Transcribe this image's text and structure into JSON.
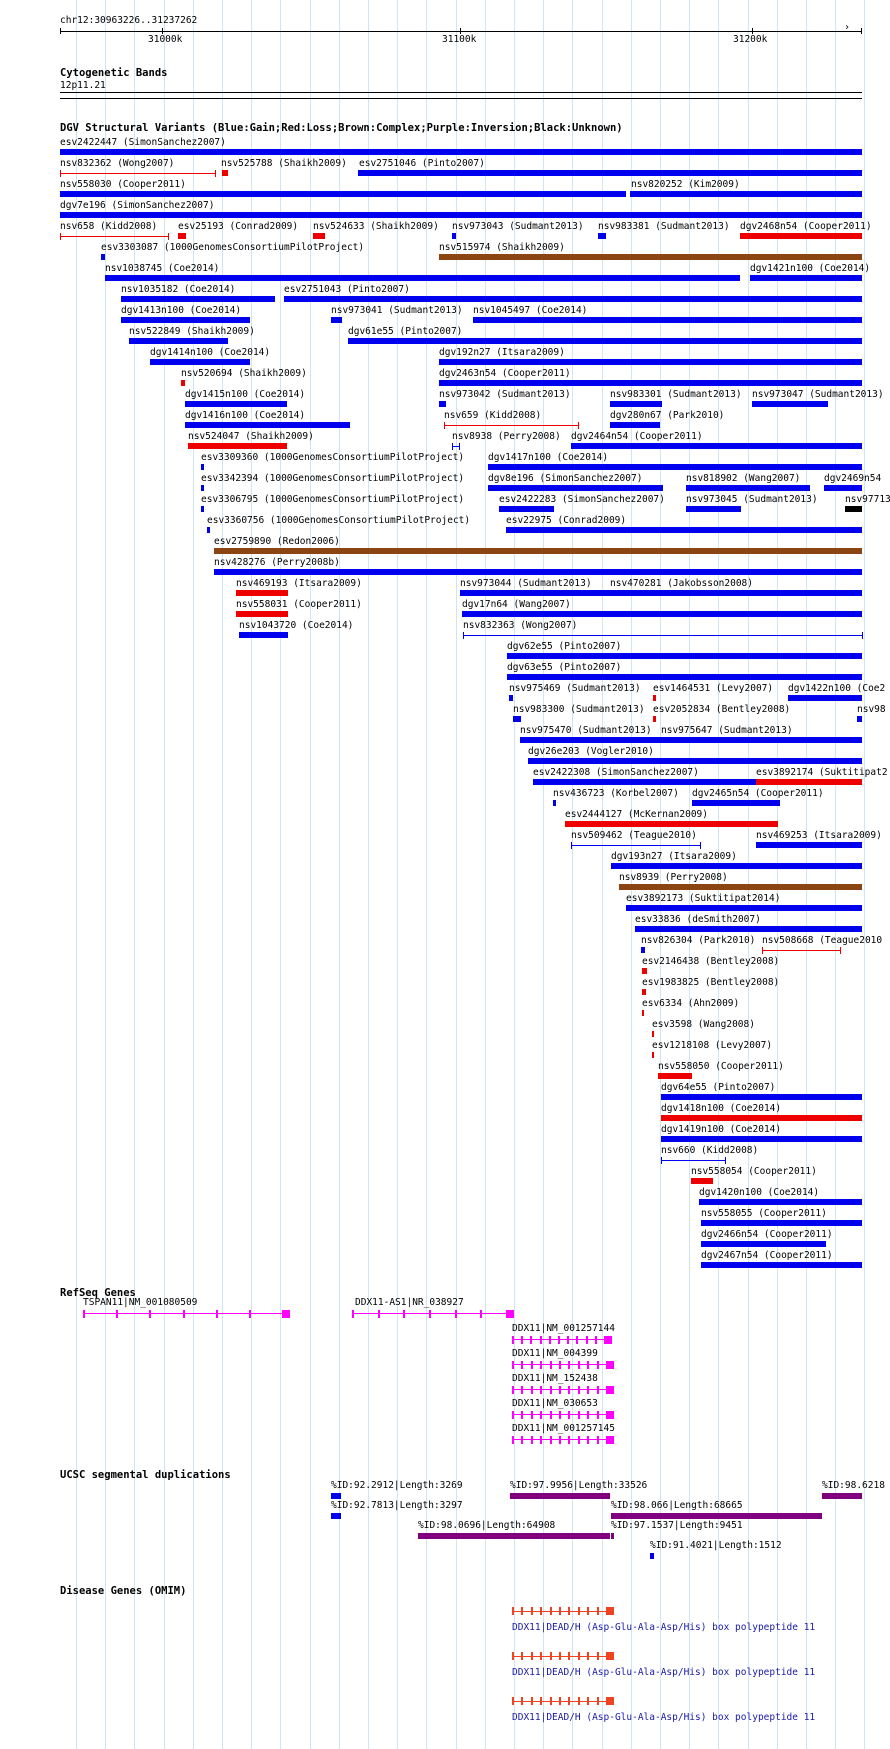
{
  "colors": {
    "gain": "#0000ee",
    "loss": "#ee0000",
    "complex": "#8b4513",
    "unknown": "#000000",
    "refseq": "#ff00ff",
    "segdup": "#800080",
    "omim": "#ee4422",
    "omim_text": "#1a1aa8",
    "grid": "#cfe6f2"
  },
  "ruler": {
    "position": "chr12:30963226..31237262",
    "ticks": [
      "31000k",
      "31100k",
      "31200k"
    ]
  },
  "cytoband": {
    "title": "Cytogenetic Bands",
    "band": "12p11.21"
  },
  "dgv": {
    "title": "DGV Structural Variants (Blue:Gain;Red:Loss;Brown:Complex;Purple:Inversion;Black:Unknown)",
    "features": [
      {
        "label": "esv2422447 (SimonSanchez2007)",
        "type": "gain"
      },
      {
        "label": "nsv832362 (Wong2007)",
        "type": "loss"
      },
      {
        "label": "nsv525788 (Shaikh2009)",
        "type": "loss"
      },
      {
        "label": "esv2751046 (Pinto2007)",
        "type": "gain"
      },
      {
        "label": "nsv558030 (Cooper2011)",
        "type": "gain"
      },
      {
        "label": "nsv820252 (Kim2009)",
        "type": "gain"
      },
      {
        "label": "dgv7e196 (SimonSanchez2007)",
        "type": "gain"
      },
      {
        "label": "nsv658 (Kidd2008)",
        "type": "loss"
      },
      {
        "label": "esv25193 (Conrad2009)",
        "type": "loss"
      },
      {
        "label": "nsv524633 (Shaikh2009)",
        "type": "loss"
      },
      {
        "label": "nsv973043 (Sudmant2013)",
        "type": "gain"
      },
      {
        "label": "nsv983381 (Sudmant2013)",
        "type": "gain"
      },
      {
        "label": "dgv2468n54 (Cooper2011)",
        "type": "loss"
      },
      {
        "label": "esv3303087 (1000GenomesConsortiumPilotProject)",
        "type": "gain"
      },
      {
        "label": "nsv515974 (Shaikh2009)",
        "type": "complex"
      },
      {
        "label": "nsv1038745 (Coe2014)",
        "type": "gain"
      },
      {
        "label": "dgv1421n100 (Coe2014)",
        "type": "gain"
      },
      {
        "label": "nsv1035182 (Coe2014)",
        "type": "gain"
      },
      {
        "label": "esv2751043 (Pinto2007)",
        "type": "gain"
      },
      {
        "label": "dgv1413n100 (Coe2014)",
        "type": "gain"
      },
      {
        "label": "nsv973041 (Sudmant2013)",
        "type": "gain"
      },
      {
        "label": "nsv1045497 (Coe2014)",
        "type": "gain"
      },
      {
        "label": "nsv522849 (Shaikh2009)",
        "type": "gain"
      },
      {
        "label": "dgv61e55 (Pinto2007)",
        "type": "gain"
      },
      {
        "label": "dgv1414n100 (Coe2014)",
        "type": "gain"
      },
      {
        "label": "dgv192n27 (Itsara2009)",
        "type": "gain"
      },
      {
        "label": "nsv520694 (Shaikh2009)",
        "type": "loss"
      },
      {
        "label": "dgv2463n54 (Cooper2011)",
        "type": "gain"
      },
      {
        "label": "dgv1415n100 (Coe2014)",
        "type": "gain"
      },
      {
        "label": "nsv973042 (Sudmant2013)",
        "type": "gain"
      },
      {
        "label": "nsv983301 (Sudmant2013)",
        "type": "gain"
      },
      {
        "label": "nsv973047 (Sudmant2013)",
        "type": "gain"
      },
      {
        "label": "dgv1416n100 (Coe2014)",
        "type": "gain"
      },
      {
        "label": "nsv659 (Kidd2008)",
        "type": "loss"
      },
      {
        "label": "dgv280n67 (Park2010)",
        "type": "gain"
      },
      {
        "label": "nsv524047 (Shaikh2009)",
        "type": "loss"
      },
      {
        "label": "nsv8938 (Perry2008)",
        "type": "gain"
      },
      {
        "label": "dgv2464n54 (Cooper2011)",
        "type": "gain"
      },
      {
        "label": "esv3309360 (1000GenomesConsortiumPilotProject)",
        "type": "gain"
      },
      {
        "label": "dgv1417n100 (Coe2014)",
        "type": "gain"
      },
      {
        "label": "esv3342394 (1000GenomesConsortiumPilotProject)",
        "type": "gain"
      },
      {
        "label": "dgv8e196 (SimonSanchez2007)",
        "type": "gain"
      },
      {
        "label": "nsv818902 (Wang2007)",
        "type": "gain"
      },
      {
        "label": "dgv2469n54",
        "type": "gain"
      },
      {
        "label": "esv3306795 (1000GenomesConsortiumPilotProject)",
        "type": "gain"
      },
      {
        "label": "esv2422283 (SimonSanchez2007)",
        "type": "gain"
      },
      {
        "label": "nsv973045 (Sudmant2013)",
        "type": "gain"
      },
      {
        "label": "nsv97713",
        "type": "unknown"
      },
      {
        "label": "esv3360756 (1000GenomesConsortiumPilotProject)",
        "type": "gain"
      },
      {
        "label": "esv22975 (Conrad2009)",
        "type": "gain"
      },
      {
        "label": "esv2759890 (Redon2006)",
        "type": "complex"
      },
      {
        "label": "nsv428276 (Perry2008b)",
        "type": "gain"
      },
      {
        "label": "nsv469193 (Itsara2009)",
        "type": "loss"
      },
      {
        "label": "nsv973044 (Sudmant2013)",
        "type": "gain"
      },
      {
        "label": "nsv470281 (Jakobsson2008)",
        "type": "gain"
      },
      {
        "label": "nsv558031 (Cooper2011)",
        "type": "loss"
      },
      {
        "label": "dgv17n64 (Wang2007)",
        "type": "gain"
      },
      {
        "label": "nsv1043720 (Coe2014)",
        "type": "gain"
      },
      {
        "label": "nsv832363 (Wong2007)",
        "type": "gain"
      },
      {
        "label": "dgv62e55 (Pinto2007)",
        "type": "gain"
      },
      {
        "label": "dgv63e55 (Pinto2007)",
        "type": "gain"
      },
      {
        "label": "nsv975469 (Sudmant2013)",
        "type": "gain"
      },
      {
        "label": "esv1464531 (Levy2007)",
        "type": "loss"
      },
      {
        "label": "dgv1422n100 (Coe2",
        "type": "gain"
      },
      {
        "label": "nsv983300 (Sudmant2013)",
        "type": "gain"
      },
      {
        "label": "esv2052834 (Bentley2008)",
        "type": "loss"
      },
      {
        "label": "nsv98",
        "type": "gain"
      },
      {
        "label": "nsv975470 (Sudmant2013)",
        "type": "gain"
      },
      {
        "label": "nsv975647 (Sudmant2013)",
        "type": "gain"
      },
      {
        "label": "dgv26e203 (Vogler2010)",
        "type": "gain"
      },
      {
        "label": "esv2422308 (SimonSanchez2007)",
        "type": "gain"
      },
      {
        "label": "esv3892174 (Suktitipat2",
        "type": "loss"
      },
      {
        "label": "nsv436723 (Korbel2007)",
        "type": "gain"
      },
      {
        "label": "dgv2465n54 (Cooper2011)",
        "type": "gain"
      },
      {
        "label": "esv2444127 (McKernan2009)",
        "type": "loss"
      },
      {
        "label": "nsv509462 (Teague2010)",
        "type": "gain"
      },
      {
        "label": "nsv469253 (Itsara2009)",
        "type": "gain"
      },
      {
        "label": "dgv193n27 (Itsara2009)",
        "type": "gain"
      },
      {
        "label": "nsv8939 (Perry2008)",
        "type": "complex"
      },
      {
        "label": "esv3892173 (Suktitipat2014)",
        "type": "gain"
      },
      {
        "label": "esv33836 (deSmith2007)",
        "type": "gain"
      },
      {
        "label": "nsv826304 (Park2010)",
        "type": "gain"
      },
      {
        "label": "nsv508668 (Teague2010",
        "type": "loss"
      },
      {
        "label": "esv2146438 (Bentley2008)",
        "type": "loss"
      },
      {
        "label": "esv1983825 (Bentley2008)",
        "type": "loss"
      },
      {
        "label": "esv6334 (Ahn2009)",
        "type": "loss"
      },
      {
        "label": "esv3598 (Wang2008)",
        "type": "loss"
      },
      {
        "label": "esv1218108 (Levy2007)",
        "type": "loss"
      },
      {
        "label": "nsv558050 (Cooper2011)",
        "type": "loss"
      },
      {
        "label": "dgv64e55 (Pinto2007)",
        "type": "gain"
      },
      {
        "label": "dgv1418n100 (Coe2014)",
        "type": "loss"
      },
      {
        "label": "dgv1419n100 (Coe2014)",
        "type": "gain"
      },
      {
        "label": "nsv660 (Kidd2008)",
        "type": "gain"
      },
      {
        "label": "nsv558054 (Cooper2011)",
        "type": "loss"
      },
      {
        "label": "dgv1420n100 (Coe2014)",
        "type": "gain"
      },
      {
        "label": "nsv558055 (Cooper2011)",
        "type": "gain"
      },
      {
        "label": "dgv2466n54 (Cooper2011)",
        "type": "gain"
      },
      {
        "label": "dgv2467n54 (Cooper2011)",
        "type": "gain"
      }
    ]
  },
  "refseq": {
    "title": "RefSeq Genes",
    "genes": [
      {
        "label": "TSPAN11|NM_001080509"
      },
      {
        "label": "DDX11-AS1|NR_038927"
      },
      {
        "label": "DDX11|NM_001257144"
      },
      {
        "label": "DDX11|NM_004399"
      },
      {
        "label": "DDX11|NM_152438"
      },
      {
        "label": "DDX11|NM_030653"
      },
      {
        "label": "DDX11|NM_001257145"
      }
    ]
  },
  "segdup": {
    "title": "UCSC segmental duplications",
    "features": [
      {
        "label": "%ID:92.2912|Length:3269",
        "color": "#0000ee"
      },
      {
        "label": "%ID:97.9956|Length:33526",
        "color": "#800080"
      },
      {
        "label": "%ID:98.6218",
        "color": "#800080"
      },
      {
        "label": "%ID:92.7813|Length:3297",
        "color": "#0000ee"
      },
      {
        "label": "%ID:98.066|Length:68665",
        "color": "#800080"
      },
      {
        "label": "%ID:98.0696|Length:64908",
        "color": "#800080"
      },
      {
        "label": "%ID:97.1537|Length:9451",
        "color": "#800080"
      },
      {
        "label": "%ID:91.4021|Length:1512",
        "color": "#0000ee"
      }
    ]
  },
  "omim": {
    "title": "Disease Genes (OMIM)",
    "genes": [
      {
        "label": "DDX11|DEAD/H (Asp-Glu-Ala-Asp/His) box polypeptide 11"
      },
      {
        "label": "DDX11|DEAD/H (Asp-Glu-Ala-Asp/His) box polypeptide 11"
      },
      {
        "label": "DDX11|DEAD/H (Asp-Glu-Ala-Asp/His) box polypeptide 11"
      }
    ]
  }
}
